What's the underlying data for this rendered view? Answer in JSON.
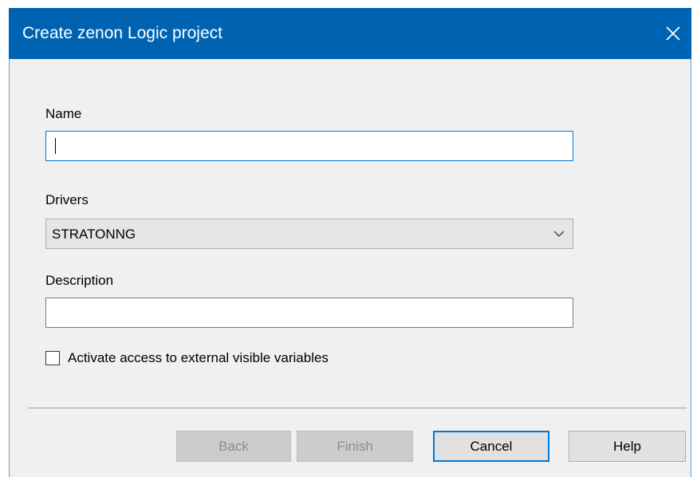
{
  "window": {
    "title": "Create zenon Logic project",
    "close_icon": "close-icon"
  },
  "form": {
    "name": {
      "label": "Name",
      "value": "",
      "placeholder": ""
    },
    "drivers": {
      "label": "Drivers",
      "selected": "STRATONNG",
      "arrow_icon": "chevron-down-icon"
    },
    "description": {
      "label": "Description",
      "value": ""
    },
    "external_access": {
      "label": "Activate access to external visible variables",
      "checked": false
    }
  },
  "buttons": {
    "back": "Back",
    "finish": "Finish",
    "cancel": "Cancel",
    "help": "Help"
  },
  "colors": {
    "titlebar": "#0063b1",
    "dialog_bg": "#f0f0f0",
    "focus_border": "#0078d7"
  }
}
